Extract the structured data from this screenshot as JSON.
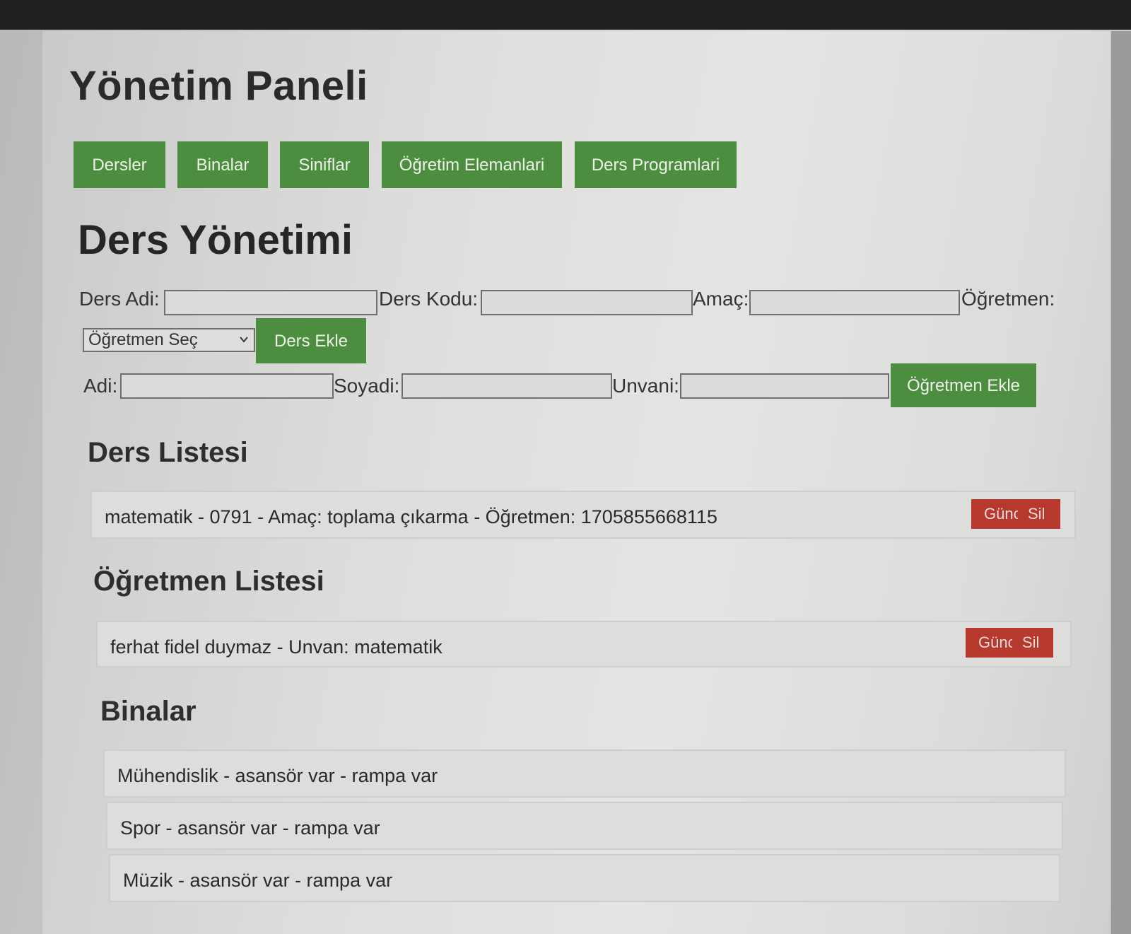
{
  "header": {
    "title": "Yönetim Paneli"
  },
  "nav": {
    "items": [
      {
        "label": "Dersler"
      },
      {
        "label": "Binalar"
      },
      {
        "label": "Siniflar"
      },
      {
        "label": "Öğretim Elemanlari"
      },
      {
        "label": "Ders Programlari"
      }
    ]
  },
  "ders_yonetimi": {
    "title": "Ders Yönetimi",
    "ders_form": {
      "ders_adi_label": "Ders Adi:",
      "ders_adi_value": "",
      "ders_kodu_label": "Ders Kodu:",
      "ders_kodu_value": "",
      "amac_label": "Amaç:",
      "amac_value": "",
      "ogretmen_label": "Öğretmen:",
      "ogretmen_select_value": "Öğretmen Seç",
      "submit_label": "Ders Ekle"
    },
    "ogretmen_form": {
      "adi_label": "Adi:",
      "adi_value": "",
      "soyadi_label": "Soyadi:",
      "soyadi_value": "",
      "unvani_label": "Unvani:",
      "unvani_value": "",
      "submit_label": "Öğretmen Ekle"
    }
  },
  "ders_listesi": {
    "title": "Ders Listesi",
    "items": [
      {
        "text": "matematik - 0791 - Amaç: toplama çıkarma - Öğretmen: 1705855668115",
        "update_label": "Güncelle",
        "delete_label": "Sil"
      }
    ]
  },
  "ogretmen_listesi": {
    "title": "Öğretmen Listesi",
    "items": [
      {
        "text": "ferhat fidel duymaz - Unvan: matematik",
        "update_label": "Güncelle",
        "delete_label": "Sil"
      }
    ]
  },
  "binalar": {
    "title": "Binalar",
    "items": [
      {
        "text": "Mühendislik - asansör var - rampa var"
      },
      {
        "text": "Spor - asansör var - rampa var"
      },
      {
        "text": "Müzik - asansör var - rampa var"
      }
    ]
  },
  "colors": {
    "primary_green": "#4c8d3f",
    "danger_red": "#b7382d"
  }
}
